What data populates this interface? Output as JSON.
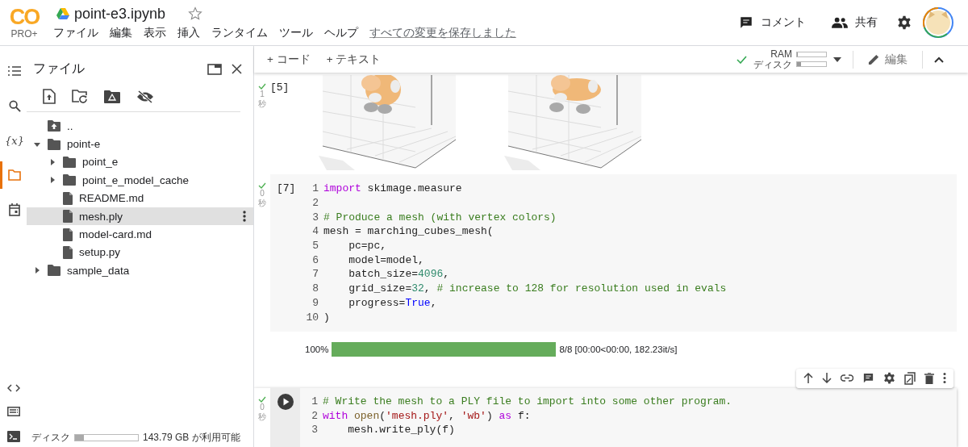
{
  "header": {
    "logo": {
      "mark": "CO",
      "tier": "PRO+"
    },
    "title": "point-e3.ipynb",
    "starred": false,
    "menu": [
      "ファイル",
      "編集",
      "表示",
      "挿入",
      "ランタイム",
      "ツール",
      "ヘルプ"
    ],
    "save_status": "すべての変更を保存しました",
    "actions": [
      {
        "kind": "comment",
        "label": "コメント"
      },
      {
        "kind": "share",
        "label": "共有"
      }
    ]
  },
  "rail": [
    {
      "kind": "toc",
      "selected": false
    },
    {
      "kind": "search",
      "selected": false
    },
    {
      "kind": "variables",
      "label": "{x}",
      "selected": false
    },
    {
      "kind": "files",
      "selected": true
    },
    {
      "kind": "calendar",
      "selected": false
    }
  ],
  "rail_bottom": [
    {
      "kind": "code"
    },
    {
      "kind": "palette"
    },
    {
      "kind": "terminal"
    }
  ],
  "sidebar": {
    "title": "ファイル",
    "tree": [
      {
        "kind": "parent",
        "name": "..",
        "selected": false
      },
      {
        "kind": "folder",
        "name": "point-e",
        "expanded": true,
        "selected": false,
        "children": [
          {
            "kind": "folder",
            "name": "point_e",
            "expanded": false,
            "selected": false
          },
          {
            "kind": "folder",
            "name": "point_e_model_cache",
            "expanded": false,
            "selected": false
          },
          {
            "kind": "file",
            "name": "README.md",
            "selected": false
          },
          {
            "kind": "file",
            "name": "mesh.ply",
            "selected": true
          },
          {
            "kind": "file",
            "name": "model-card.md",
            "selected": false
          },
          {
            "kind": "file",
            "name": "setup.py",
            "selected": false
          }
        ]
      },
      {
        "kind": "folder",
        "name": "sample_data",
        "expanded": false,
        "selected": false
      }
    ],
    "disk": {
      "label": "ディスク",
      "level": 0.14,
      "text": "143.79 GB が利用可能"
    }
  },
  "toolbar": {
    "add": [
      "+ コード",
      "+ テキスト"
    ],
    "connected": true,
    "meters": [
      {
        "label": "RAM",
        "level": 0.04
      },
      {
        "label": "ディスク",
        "level": 0.14
      }
    ],
    "edit": "編集"
  },
  "cells": [
    {
      "kind": "output",
      "ok": true,
      "time": "1",
      "unit": "秒",
      "count": "[5]"
    },
    {
      "kind": "code",
      "ok": true,
      "time": "0",
      "unit": "秒",
      "count": "[7]",
      "focused": false,
      "lines": [
        {
          "no": "1",
          "tokens": [
            {
              "kind": "kw",
              "s": "import"
            },
            {
              "kind": "plain",
              "s": " skimage.measure"
            }
          ]
        },
        {
          "no": "2"
        },
        {
          "no": "3",
          "tokens": [
            {
              "kind": "comment",
              "s": "# Produce a mesh (with vertex colors)"
            }
          ]
        },
        {
          "no": "4",
          "tokens": [
            {
              "kind": "plain",
              "s": "mesh = marching_cubes_mesh("
            }
          ]
        },
        {
          "no": "5",
          "tokens": [
            {
              "kind": "plain",
              "s": "    pc=pc,"
            }
          ]
        },
        {
          "no": "6",
          "tokens": [
            {
              "kind": "plain",
              "s": "    model=model,"
            }
          ]
        },
        {
          "no": "7",
          "tokens": [
            {
              "kind": "plain",
              "s": "    batch_size="
            },
            {
              "kind": "num",
              "s": "4096"
            },
            {
              "kind": "plain",
              "s": ","
            }
          ]
        },
        {
          "no": "8",
          "tokens": [
            {
              "kind": "plain",
              "s": "    grid_size="
            },
            {
              "kind": "num",
              "s": "32"
            },
            {
              "kind": "plain",
              "s": ", "
            },
            {
              "kind": "comment",
              "s": "# increase to 128 for resolution used in evals"
            }
          ]
        },
        {
          "no": "9",
          "tokens": [
            {
              "kind": "plain",
              "s": "    progress="
            },
            {
              "kind": "const",
              "s": "True"
            },
            {
              "kind": "plain",
              "s": ","
            }
          ]
        },
        {
          "no": "10",
          "tokens": [
            {
              "kind": "plain",
              "s": ")"
            }
          ]
        }
      ],
      "progress": {
        "percent": "100%",
        "level": 1,
        "text": "8/8 [00:00<00:00, 182.23it/s]"
      }
    },
    {
      "kind": "code",
      "ok": true,
      "time": "0",
      "unit": "秒",
      "focused": true,
      "lines": [
        {
          "no": "1",
          "tokens": [
            {
              "kind": "comment",
              "s": "# Write the mesh to a PLY file to import into some other program."
            }
          ]
        },
        {
          "no": "2",
          "tokens": [
            {
              "kind": "kw",
              "s": "with"
            },
            {
              "kind": "fn",
              "s": " open"
            },
            {
              "kind": "plain",
              "s": "("
            },
            {
              "kind": "str",
              "s": "'mesh.ply'"
            },
            {
              "kind": "plain",
              "s": ", "
            },
            {
              "kind": "str",
              "s": "'wb'"
            },
            {
              "kind": "plain",
              "s": ") "
            },
            {
              "kind": "kw",
              "s": "as"
            },
            {
              "kind": "plain",
              "s": " f:"
            }
          ]
        },
        {
          "no": "3",
          "tokens": [
            {
              "kind": "plain",
              "s": "    mesh.write_ply(f)"
            }
          ]
        }
      ]
    }
  ]
}
